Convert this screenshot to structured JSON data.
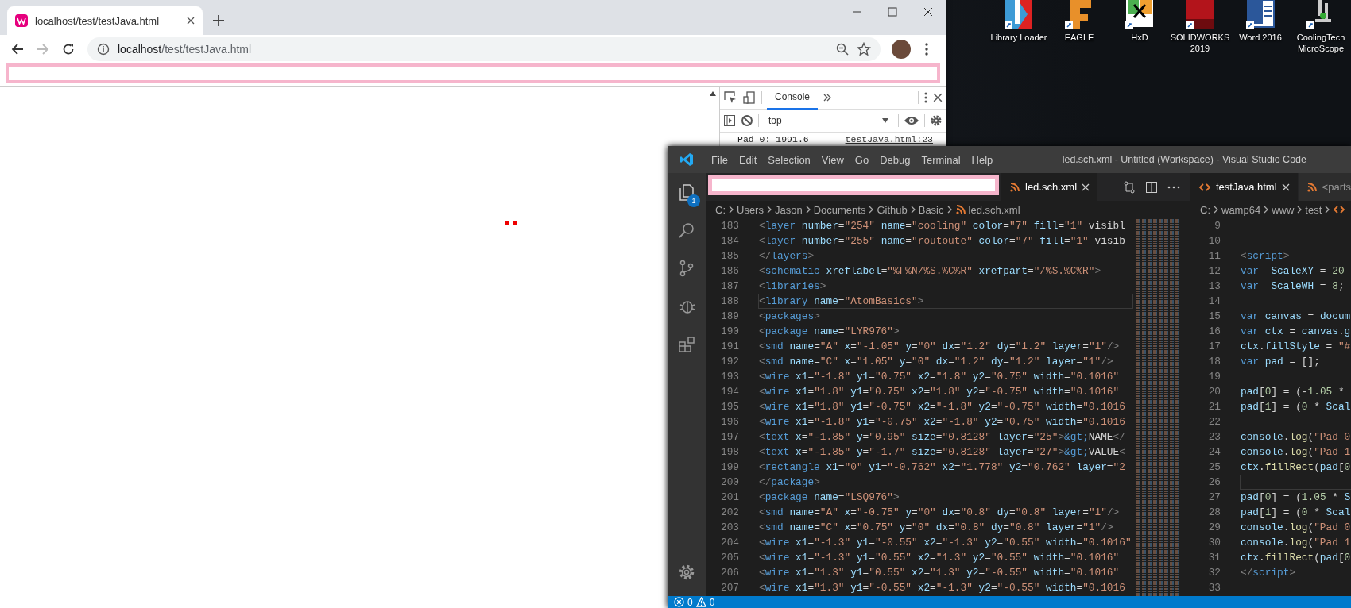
{
  "desktop": {
    "icons": [
      {
        "label": "Library Loader",
        "kind": "loader"
      },
      {
        "label": "EAGLE",
        "kind": "eagle"
      },
      {
        "label": "HxD",
        "kind": "hex"
      },
      {
        "label": "SOLIDWORKS 2019",
        "kind": "cad"
      },
      {
        "label": "Word 2016",
        "kind": "word"
      },
      {
        "label": "CoolingTech MicroScope",
        "kind": "microscope"
      }
    ]
  },
  "browser": {
    "tab": {
      "title": "localhost/test/testJava.html"
    },
    "navigation": {
      "back_enabled": true,
      "forward_enabled": false
    },
    "address_bar": {
      "host": "localhost",
      "path": "/test/testJava.html"
    },
    "devtools": {
      "tabs": [
        {
          "label": "Console",
          "selected": true
        }
      ],
      "context": "top",
      "console": [
        {
          "message": "Pad 0: 1991.6",
          "source": "testJava.html:23"
        }
      ]
    }
  },
  "vscode": {
    "title": "led.sch.xml - Untitled (Workspace) - Visual Studio Code",
    "menu": [
      "File",
      "Edit",
      "Selection",
      "View",
      "Go",
      "Debug",
      "Terminal",
      "Help"
    ],
    "explorer_badge": "1",
    "groups": [
      {
        "kind": "xml",
        "tabs": [
          {
            "label": "led.sch.xml",
            "kind": "xml",
            "selected": true
          }
        ],
        "breadcrumb": {
          "folders": [
            "C:",
            "Users",
            "Jason",
            "Documents",
            "Github",
            "Basic"
          ],
          "file": "led.sch.xml",
          "kind": "xml"
        },
        "lines": [
          {
            "number": "183",
            "code": "<layer number=\"254\" name=\"cooling\" color=\"7\" fill=\"1\" visibl",
            "current": false
          },
          {
            "number": "184",
            "code": "<layer number=\"255\" name=\"routoute\" color=\"7\" fill=\"1\" visib",
            "current": false
          },
          {
            "number": "185",
            "code": "</layers>",
            "current": false
          },
          {
            "number": "186",
            "code": "<schematic xreflabel=\"%F%N/%S.%C%R\" xrefpart=\"/%S.%C%R\">",
            "current": false
          },
          {
            "number": "187",
            "code": "<libraries>",
            "current": false
          },
          {
            "number": "188",
            "code": "<library name=\"AtomBasics\">",
            "current": true
          },
          {
            "number": "189",
            "code": "<packages>",
            "current": false
          },
          {
            "number": "190",
            "code": "<package name=\"LYR976\">",
            "current": false
          },
          {
            "number": "191",
            "code": "<smd name=\"A\" x=\"-1.05\" y=\"0\" dx=\"1.2\" dy=\"1.2\" layer=\"1\"/>",
            "current": false
          },
          {
            "number": "192",
            "code": "<smd name=\"C\" x=\"1.05\" y=\"0\" dx=\"1.2\" dy=\"1.2\" layer=\"1\"/>",
            "current": false
          },
          {
            "number": "193",
            "code": "<wire x1=\"-1.8\" y1=\"0.75\" x2=\"1.8\" y2=\"0.75\" width=\"0.1016\"",
            "current": false
          },
          {
            "number": "194",
            "code": "<wire x1=\"1.8\" y1=\"0.75\" x2=\"1.8\" y2=\"-0.75\" width=\"0.1016\"",
            "current": false
          },
          {
            "number": "195",
            "code": "<wire x1=\"1.8\" y1=\"-0.75\" x2=\"-1.8\" y2=\"-0.75\" width=\"0.1016",
            "current": false
          },
          {
            "number": "196",
            "code": "<wire x1=\"-1.8\" y1=\"-0.75\" x2=\"-1.8\" y2=\"0.75\" width=\"0.1016",
            "current": false
          },
          {
            "number": "197",
            "code": "<text x=\"-1.85\" y=\"0.95\" size=\"0.8128\" layer=\"25\">&gt;NAME</",
            "current": false
          },
          {
            "number": "198",
            "code": "<text x=\"-1.85\" y=\"-1.7\" size=\"0.8128\" layer=\"27\">&gt;VALUE<",
            "current": false
          },
          {
            "number": "199",
            "code": "<rectangle x1=\"0\" y1=\"-0.762\" x2=\"1.778\" y2=\"0.762\" layer=\"2",
            "current": false
          },
          {
            "number": "200",
            "code": "</package>",
            "current": false
          },
          {
            "number": "201",
            "code": "<package name=\"LSQ976\">",
            "current": false
          },
          {
            "number": "202",
            "code": "<smd name=\"A\" x=\"-0.75\" y=\"0\" dx=\"0.8\" dy=\"0.8\" layer=\"1\"/>",
            "current": false
          },
          {
            "number": "203",
            "code": "<smd name=\"C\" x=\"0.75\" y=\"0\" dx=\"0.8\" dy=\"0.8\" layer=\"1\"/>",
            "current": false
          },
          {
            "number": "204",
            "code": "<wire x1=\"-1.3\" y1=\"-0.55\" x2=\"-1.3\" y2=\"0.55\" width=\"0.1016\"",
            "current": false
          },
          {
            "number": "205",
            "code": "<wire x1=\"-1.3\" y1=\"0.55\" x2=\"1.3\" y2=\"0.55\" width=\"0.1016\"",
            "current": false
          },
          {
            "number": "206",
            "code": "<wire x1=\"1.3\" y1=\"0.55\" x2=\"1.3\" y2=\"-0.55\" width=\"0.1016\"",
            "current": false
          },
          {
            "number": "207",
            "code": "<wire x1=\"1.3\" y1=\"-0.55\" x2=\"-1.3\" y2=\"-0.55\" width=\"0.1016",
            "current": false
          }
        ]
      },
      {
        "kind": "js",
        "tabs": [
          {
            "label": "testJava.html",
            "kind": "html",
            "selected": true
          },
          {
            "label": "<parts",
            "kind": "xml",
            "selected": false
          }
        ],
        "breadcrumb": {
          "folders": [
            "C:",
            "wamp64",
            "www",
            "test"
          ],
          "kind": "html"
        },
        "lines": [
          {
            "number": "9",
            "current": false
          },
          {
            "number": "10",
            "current": false
          },
          {
            "number": "11",
            "code": "<script>",
            "current": false
          },
          {
            "number": "12",
            "code": "var  ScaleXY = 20",
            "current": false
          },
          {
            "number": "13",
            "code": "var  ScaleWH = 8;",
            "current": false
          },
          {
            "number": "14",
            "current": false
          },
          {
            "number": "15",
            "code": "var canvas = docum",
            "current": false
          },
          {
            "number": "16",
            "code": "var ctx = canvas.g",
            "current": false
          },
          {
            "number": "17",
            "code": "ctx.fillStyle = \"#",
            "current": false
          },
          {
            "number": "18",
            "code": "var pad = [];",
            "current": false
          },
          {
            "number": "19",
            "current": false
          },
          {
            "number": "20",
            "code": "pad[0] = (-1.05 *",
            "current": false
          },
          {
            "number": "21",
            "code": "pad[1] = (0 * Scal",
            "current": false
          },
          {
            "number": "22",
            "current": false
          },
          {
            "number": "23",
            "code": "console.log(\"Pad 0",
            "current": false
          },
          {
            "number": "24",
            "code": "console.log(\"Pad 1",
            "current": false
          },
          {
            "number": "25",
            "code": "ctx.fillRect(pad[0",
            "current": false
          },
          {
            "number": "26",
            "current": true
          },
          {
            "number": "27",
            "code": "pad[0] = (1.05 * S",
            "current": false
          },
          {
            "number": "28",
            "code": "pad[1] = (0 * Scal",
            "current": false
          },
          {
            "number": "29",
            "code": "console.log(\"Pad 0",
            "current": false
          },
          {
            "number": "30",
            "code": "console.log(\"Pad 1",
            "current": false
          },
          {
            "number": "31",
            "code": "ctx.fillRect(pad[0",
            "current": false
          },
          {
            "number": "32",
            "code": "</script>",
            "current": false
          },
          {
            "number": "33",
            "current": false
          }
        ]
      }
    ],
    "status_bar": {
      "errors": "0",
      "warnings": "0"
    }
  }
}
